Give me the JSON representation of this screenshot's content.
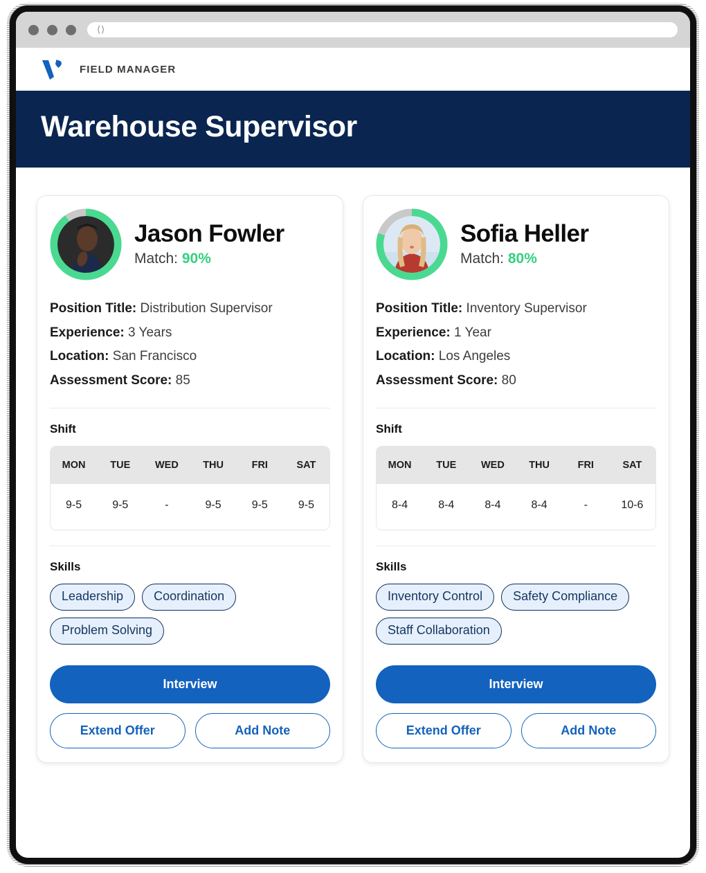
{
  "browser": {
    "nav_back_icon": "chevron-left-icon",
    "nav_forward_icon": "chevron-right-icon",
    "address_value": ""
  },
  "appbar": {
    "brand": "FIELD MANAGER",
    "logo_icon": "v-logo-icon"
  },
  "hero": {
    "title": "Warehouse Supervisor"
  },
  "labels": {
    "match_prefix": "Match:",
    "position_title": "Position Title:",
    "experience": "Experience:",
    "location": "Location:",
    "assessment_score": "Assessment Score:",
    "shift_heading": "Shift",
    "skills_heading": "Skills"
  },
  "shift_days": [
    "MON",
    "TUE",
    "WED",
    "THU",
    "FRI",
    "SAT"
  ],
  "buttons": {
    "interview": "Interview",
    "extend_offer": "Extend Offer",
    "add_note": "Add Note"
  },
  "colors": {
    "navy": "#0a2650",
    "primary_blue": "#1362bd",
    "match_green": "#35d07f",
    "ring_track": "#c9c9c9",
    "chip_fill": "#e6effc",
    "chip_border": "#0e2f57"
  },
  "candidates": [
    {
      "name": "Jason Fowler",
      "match": "90%",
      "match_value": 90,
      "avatar_icon": "avatar-photo-male",
      "position_title": "Distribution Supervisor",
      "experience": "3 Years",
      "location": "San Francisco",
      "assessment_score": "85",
      "shift": [
        "9-5",
        "9-5",
        "-",
        "9-5",
        "9-5",
        "9-5"
      ],
      "skills": [
        "Leadership",
        "Coordination",
        "Problem Solving"
      ]
    },
    {
      "name": "Sofia Heller",
      "match": "80%",
      "match_value": 80,
      "avatar_icon": "avatar-photo-female",
      "position_title": "Inventory Supervisor",
      "experience": "1 Year",
      "location": "Los Angeles",
      "assessment_score": "80",
      "shift": [
        "8-4",
        "8-4",
        "8-4",
        "8-4",
        "-",
        "10-6"
      ],
      "skills": [
        "Inventory Control",
        "Safety Compliance",
        "Staff Collaboration"
      ]
    }
  ]
}
